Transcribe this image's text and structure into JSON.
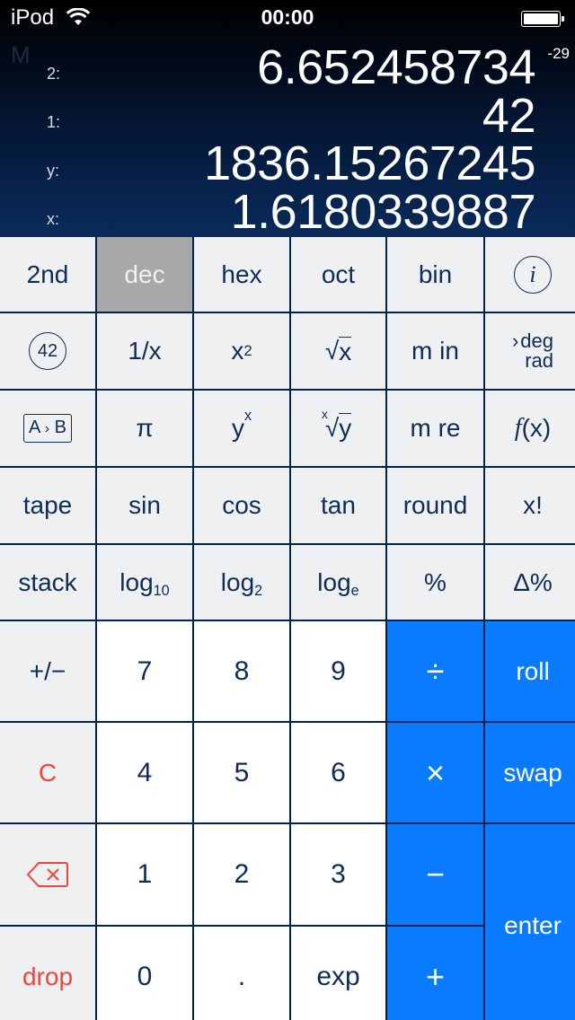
{
  "status_bar": {
    "carrier": "iPod",
    "wifi_icon": "wifi-icon",
    "time": "00:00",
    "battery_icon": "battery-full-icon",
    "battery_level": 1.0
  },
  "display": {
    "memory_indicator": "M",
    "stack": [
      {
        "label": "2:",
        "value": "6.652458734",
        "exponent": "-29"
      },
      {
        "label": "1:",
        "value": "42"
      },
      {
        "label": "y:",
        "value": "1836.15267245"
      },
      {
        "label": "x:",
        "value": "1.6180339887"
      }
    ]
  },
  "keys": {
    "row1": {
      "second": "2nd",
      "dec": "dec",
      "hex": "hex",
      "oct": "oct",
      "bin": "bin",
      "info": "i"
    },
    "row2": {
      "answer": "42",
      "reciprocal": "1/x",
      "square_base": "x",
      "square_exp": "2",
      "sqrt_sym": "√",
      "sqrt_arg": "x",
      "mem_in": "m in",
      "degrad_arrow": "›",
      "deg": "deg",
      "rad": "rad"
    },
    "row3": {
      "ab_a": "A",
      "ab_arrow": "›",
      "ab_b": "B",
      "pi": "π",
      "pow_base": "y",
      "pow_exp": "x",
      "root_index": "x",
      "root_sym": "√",
      "root_arg": "y",
      "mem_recall": "m re",
      "func_f": "f",
      "func_arg": "(x)"
    },
    "row4": {
      "tape": "tape",
      "sin": "sin",
      "cos": "cos",
      "tan": "tan",
      "round": "round",
      "factorial": "x!"
    },
    "row5": {
      "stack": "stack",
      "log10": "log",
      "log10_sub": "10",
      "log2": "log",
      "log2_sub": "2",
      "loge": "log",
      "loge_sub": "e",
      "percent": "%",
      "delta_percent": "Δ%"
    },
    "row6": {
      "plusminus": "+/−",
      "seven": "7",
      "eight": "8",
      "nine": "9",
      "divide": "÷",
      "roll": "roll"
    },
    "row7": {
      "clear": "C",
      "four": "4",
      "five": "5",
      "six": "6",
      "multiply": "×",
      "swap": "swap"
    },
    "row8": {
      "backspace_icon": "backspace-icon",
      "one": "1",
      "two": "2",
      "three": "3",
      "minus": "−",
      "enter": "enter"
    },
    "row9": {
      "drop": "drop",
      "zero": "0",
      "decimal": ".",
      "exp": "exp",
      "plus": "+"
    }
  },
  "colors": {
    "accent": "#0a7bff",
    "destructive": "#f2443a",
    "key_text": "#0e2c58",
    "selected_mode": "#a7a8aa"
  }
}
